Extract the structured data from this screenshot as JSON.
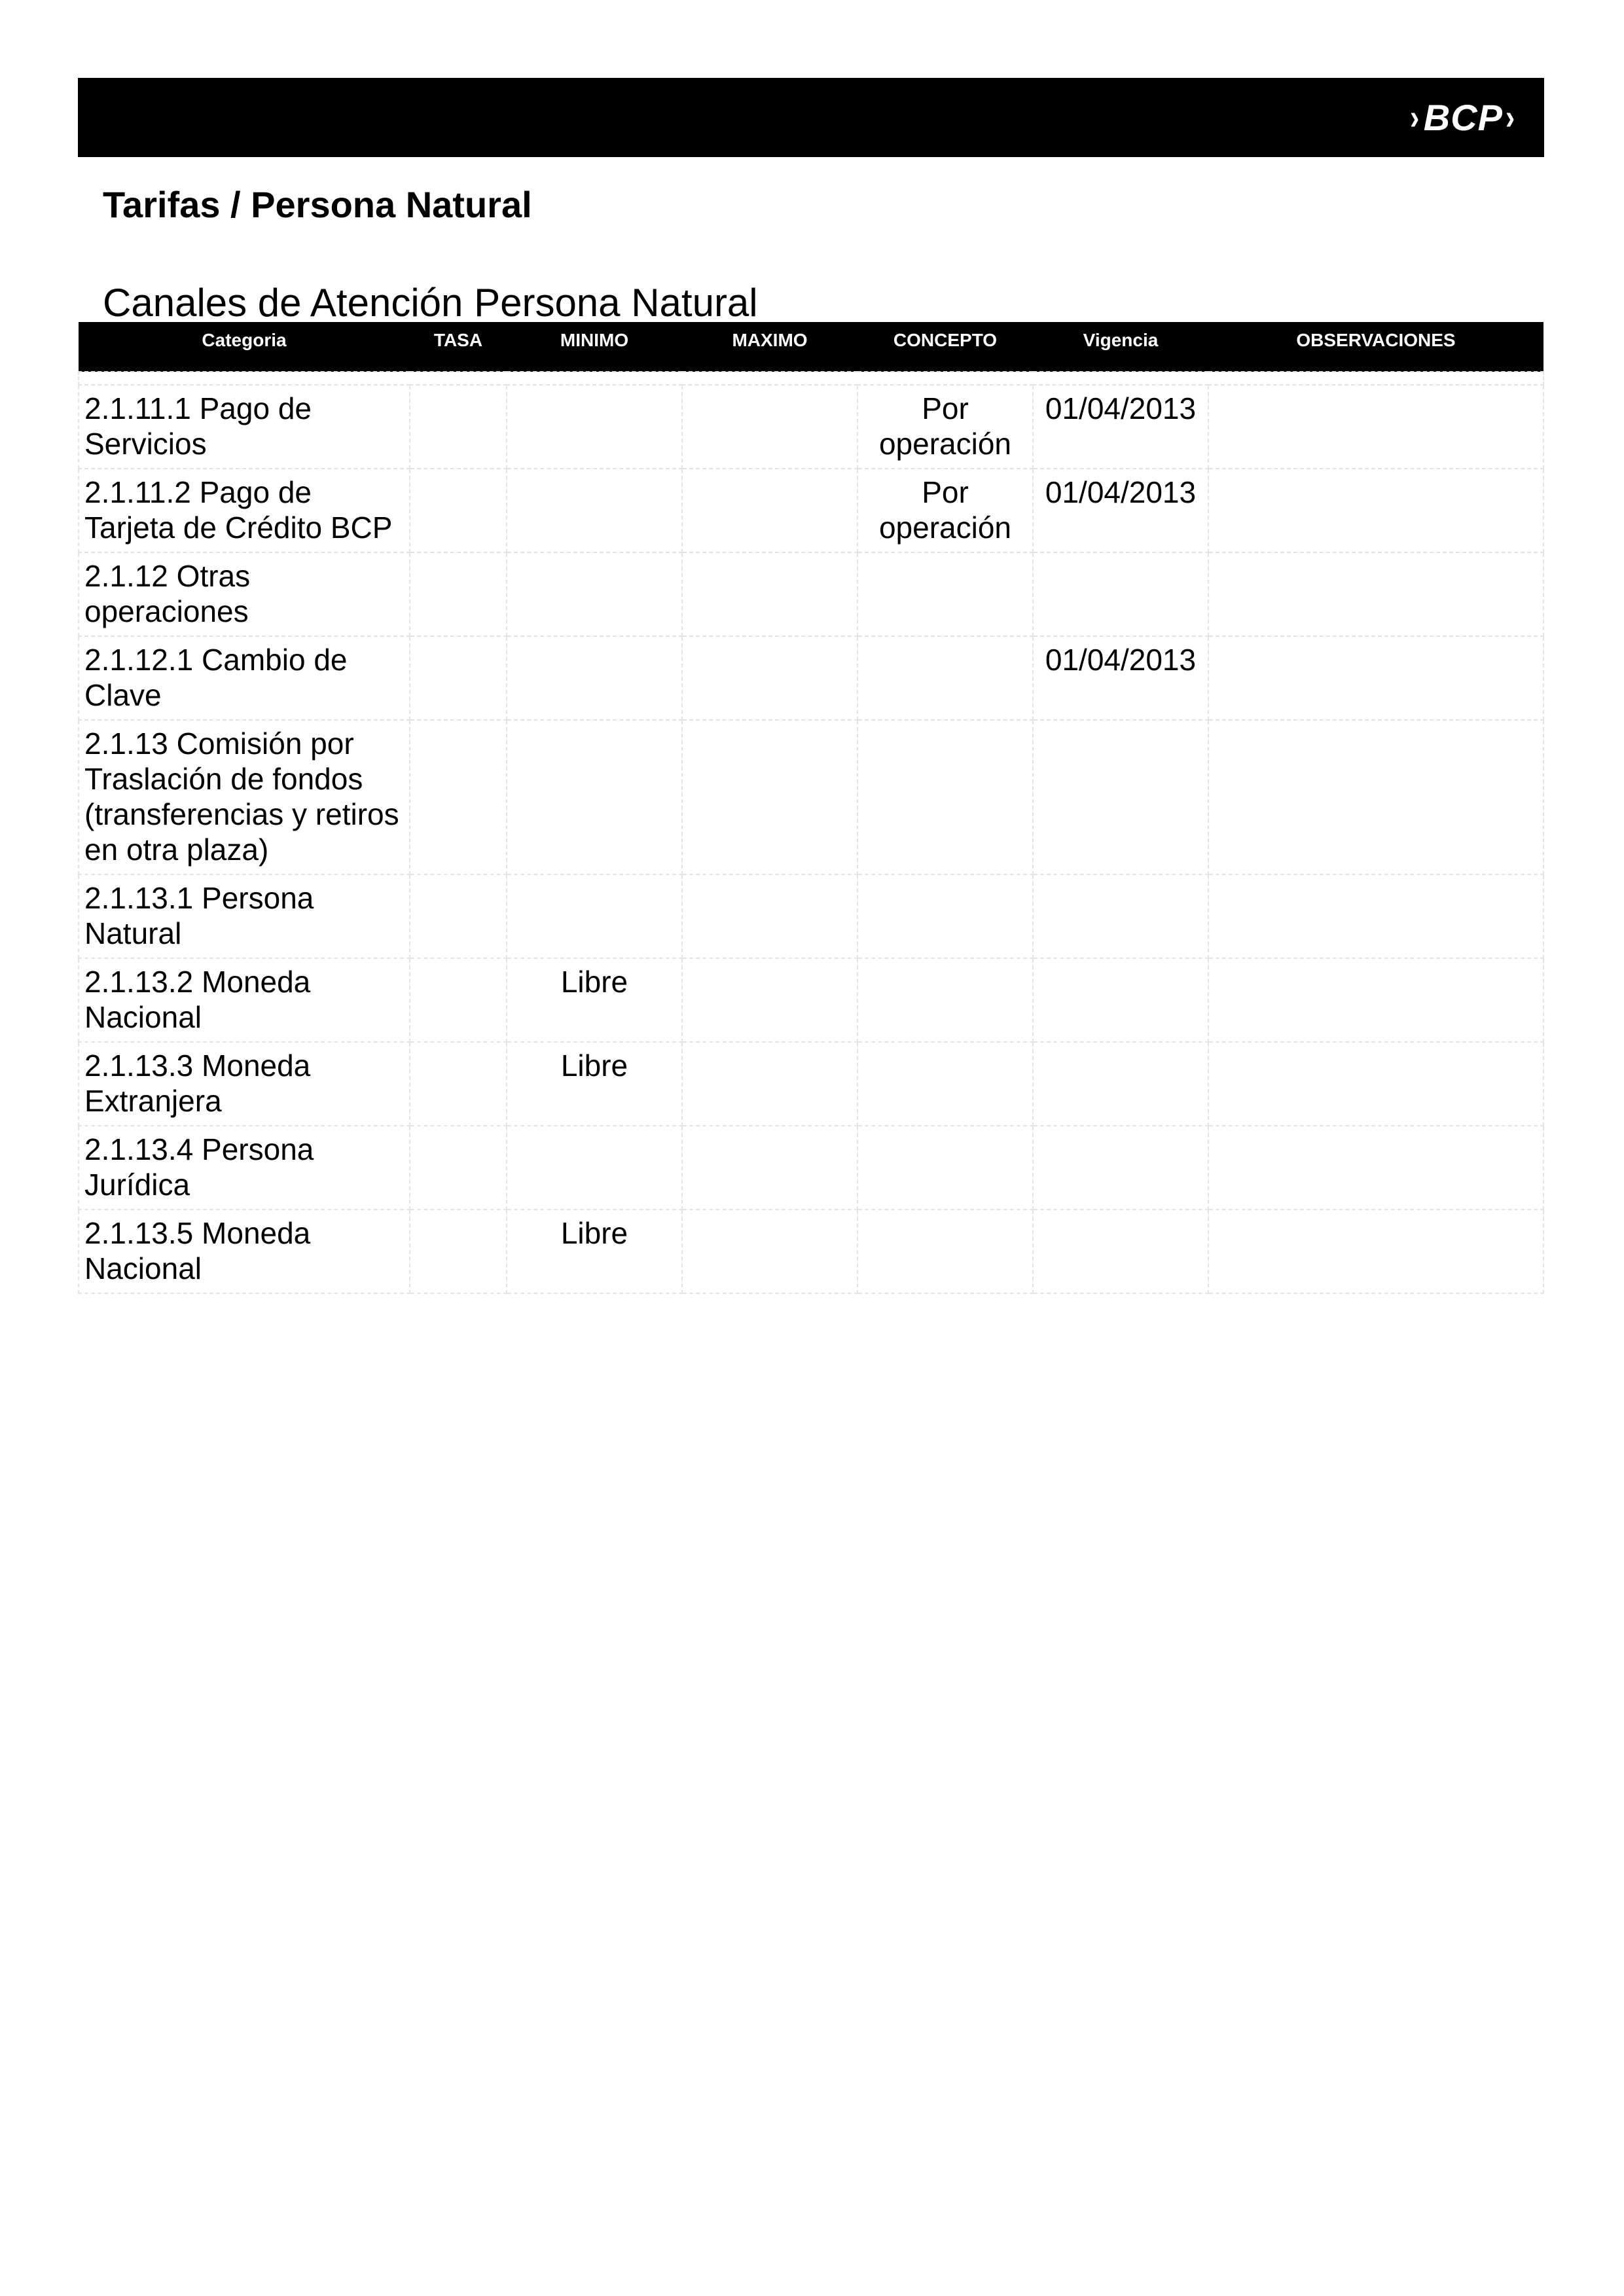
{
  "header": {
    "logo_text": "BCP",
    "logo_left_glyph": "›",
    "logo_right_glyph": "›",
    "bar_color": "#000000"
  },
  "page_title": "Tarifas / Persona Natural",
  "section_title": "Canales de Atención Persona Natural",
  "table": {
    "columns": [
      "Categoria",
      "TASA",
      "MINIMO",
      "MAXIMO",
      "CONCEPTO",
      "Vigencia",
      "OBSERVACIONES"
    ],
    "rows": [
      {
        "categoria": "2.1.11.1 Pago de Servicios",
        "tasa": "",
        "minimo": "",
        "maximo": "",
        "concepto": "Por operación",
        "vigencia": "01/04/2013",
        "observaciones": ""
      },
      {
        "categoria": "2.1.11.2 Pago de Tarjeta de Crédito BCP",
        "tasa": "",
        "minimo": "",
        "maximo": "",
        "concepto": "Por operación",
        "vigencia": "01/04/2013",
        "observaciones": ""
      },
      {
        "categoria": "2.1.12 Otras operaciones",
        "tasa": "",
        "minimo": "",
        "maximo": "",
        "concepto": "",
        "vigencia": "",
        "observaciones": ""
      },
      {
        "categoria": "2.1.12.1 Cambio de Clave",
        "tasa": "",
        "minimo": "",
        "maximo": "",
        "concepto": "",
        "vigencia": "01/04/2013",
        "observaciones": ""
      },
      {
        "categoria": "2.1.13 Comisión por Traslación de fondos (transferencias y retiros en otra plaza)",
        "tasa": "",
        "minimo": "",
        "maximo": "",
        "concepto": "",
        "vigencia": "",
        "observaciones": ""
      },
      {
        "categoria": "2.1.13.1 Persona Natural",
        "tasa": "",
        "minimo": "",
        "maximo": "",
        "concepto": "",
        "vigencia": "",
        "observaciones": ""
      },
      {
        "categoria": "2.1.13.2 Moneda Nacional",
        "tasa": "",
        "minimo": "Libre",
        "maximo": "",
        "concepto": "",
        "vigencia": "",
        "observaciones": ""
      },
      {
        "categoria": "2.1.13.3 Moneda Extranjera",
        "tasa": "",
        "minimo": "Libre",
        "maximo": "",
        "concepto": "",
        "vigencia": "",
        "observaciones": ""
      },
      {
        "categoria": "2.1.13.4 Persona Jurídica",
        "tasa": "",
        "minimo": "",
        "maximo": "",
        "concepto": "",
        "vigencia": "",
        "observaciones": ""
      },
      {
        "categoria": "2.1.13.5 Moneda Nacional",
        "tasa": "",
        "minimo": "Libre",
        "maximo": "",
        "concepto": "",
        "vigencia": "",
        "observaciones": ""
      }
    ]
  }
}
